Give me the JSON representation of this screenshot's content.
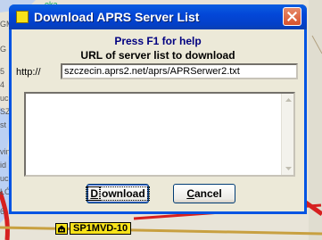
{
  "map": {
    "left_labels": [
      "GM",
      "G",
      "5",
      "4",
      "uc",
      "SZE",
      "st",
      "",
      "vina",
      "id",
      "ucz",
      "ŁÓW",
      "6",
      ""
    ],
    "town_fragment": "eka",
    "station_label": "SP1MVD-10",
    "road_color": "#d62020",
    "water_color": "#a8c8ff"
  },
  "dialog": {
    "title": "Download APRS Server List",
    "help_text": "Press F1 for help",
    "url_caption": "URL of server list to download",
    "url_prefix": "http://",
    "url_value": "szczecin.aprs2.net/aprs/APRSerwer2.txt",
    "log_text": "",
    "download_label": "Download",
    "download_accel": "D",
    "download_rest": "ownload",
    "cancel_label": "Cancel",
    "cancel_accel": "C",
    "cancel_rest": "ancel",
    "title_color": "#0054e3",
    "help_color": "#000080"
  }
}
